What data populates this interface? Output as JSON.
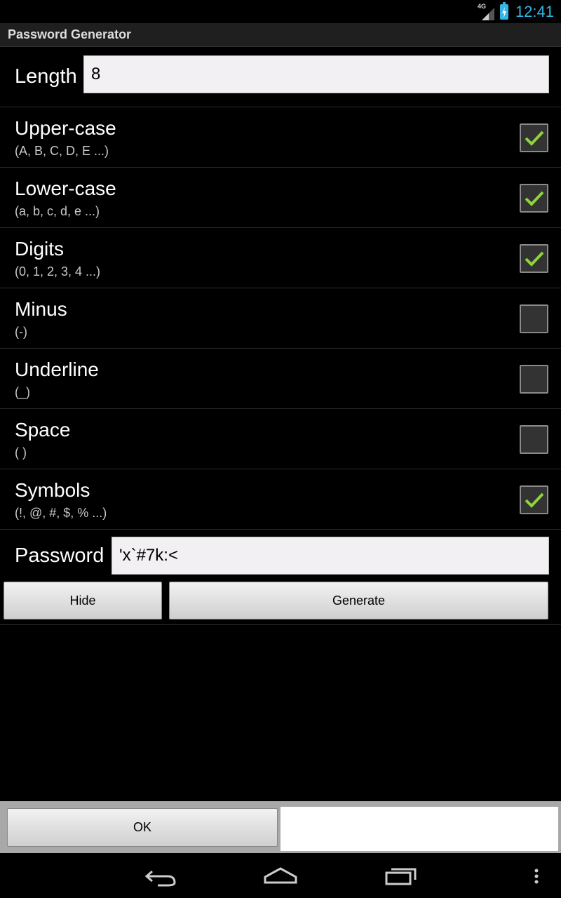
{
  "status_bar": {
    "network": "4G",
    "time": "12:41"
  },
  "app": {
    "title": "Password Generator"
  },
  "length": {
    "label": "Length",
    "value": "8"
  },
  "options": [
    {
      "title": "Upper-case",
      "subtitle": "(A, B, C, D, E ...)",
      "checked": true
    },
    {
      "title": "Lower-case",
      "subtitle": "(a, b, c, d, e ...)",
      "checked": true
    },
    {
      "title": "Digits",
      "subtitle": "(0, 1, 2, 3, 4 ...)",
      "checked": true
    },
    {
      "title": "Minus",
      "subtitle": "(-)",
      "checked": false
    },
    {
      "title": "Underline",
      "subtitle": "(_)",
      "checked": false
    },
    {
      "title": "Space",
      "subtitle": "( )",
      "checked": false
    },
    {
      "title": "Symbols",
      "subtitle": "(!, @, #, $, % ...)",
      "checked": true
    }
  ],
  "password": {
    "label": "Password",
    "value": "'x`#7k:<"
  },
  "buttons": {
    "hide": "Hide",
    "generate": "Generate",
    "ok": "OK"
  },
  "colors": {
    "accent": "#33b5e5",
    "check": "#8fd43a"
  },
  "nav": {
    "back": "back-icon",
    "home": "home-icon",
    "recents": "recents-icon",
    "menu": "overflow-menu-icon"
  }
}
